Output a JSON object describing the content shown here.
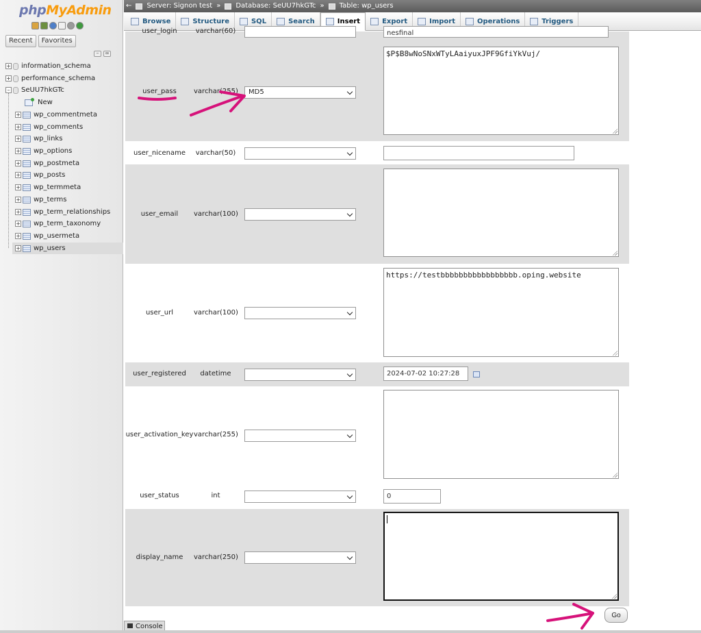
{
  "logo": {
    "php": "php",
    "myadmin": "MyAdmin"
  },
  "nav": {
    "tabs": [
      "Recent",
      "Favorites"
    ],
    "databases": [
      "information_schema",
      "performance_schema",
      "SeUU7hkGTc"
    ],
    "new_label": "New",
    "tables": [
      "wp_commentmeta",
      "wp_comments",
      "wp_links",
      "wp_options",
      "wp_postmeta",
      "wp_posts",
      "wp_termmeta",
      "wp_terms",
      "wp_term_relationships",
      "wp_term_taxonomy",
      "wp_usermeta",
      "wp_users"
    ],
    "active_table": "wp_users"
  },
  "breadcrumb": {
    "server": "Server: Signon test",
    "database": "Database: SeUU7hkGTc",
    "table": "Table: wp_users",
    "sep": "»"
  },
  "tabs": [
    "Browse",
    "Structure",
    "SQL",
    "Search",
    "Insert",
    "Export",
    "Import",
    "Operations",
    "Triggers"
  ],
  "active_tab": "Insert",
  "fields": [
    {
      "name": "user_login",
      "type": "varchar(60)",
      "function": "",
      "value": "nesfinal"
    },
    {
      "name": "user_pass",
      "type": "varchar(255)",
      "function": "MD5",
      "value": "$P$B8wNoSNxWTyLAaiyuxJPF9GfiYkVuj/"
    },
    {
      "name": "user_nicename",
      "type": "varchar(50)",
      "function": "",
      "value": ""
    },
    {
      "name": "user_email",
      "type": "varchar(100)",
      "function": "",
      "value": ""
    },
    {
      "name": "user_url",
      "type": "varchar(100)",
      "function": "",
      "value": "https://testbbbbbbbbbbbbbbbbb.oping.website"
    },
    {
      "name": "user_registered",
      "type": "datetime",
      "function": "",
      "value": "2024-07-02 10:27:28"
    },
    {
      "name": "user_activation_key",
      "type": "varchar(255)",
      "function": "",
      "value": ""
    },
    {
      "name": "user_status",
      "type": "int",
      "function": "",
      "value": "0"
    },
    {
      "name": "display_name",
      "type": "varchar(250)",
      "function": "",
      "value": ""
    }
  ],
  "go_label": "Go",
  "console_label": "Console",
  "colors": {
    "annotation": "#d6127a",
    "php": "#6c78af",
    "myadmin": "#f89c0e",
    "link": "#235a81"
  }
}
